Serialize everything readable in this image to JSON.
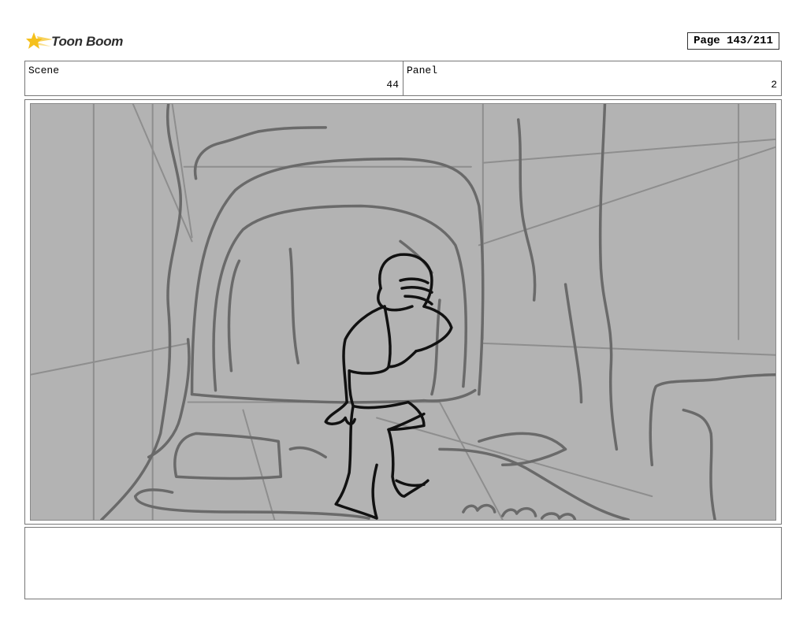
{
  "header": {
    "logo_text": "Toon Boom",
    "page_indicator": "Page 143/211"
  },
  "info": {
    "scene_label": "Scene",
    "scene_value": "44",
    "panel_label": "Panel",
    "panel_value": "2"
  },
  "panel": {
    "background_color": "#b3b3b3",
    "line_color": "#6a6a6a",
    "character_color": "#111111"
  },
  "notes": {
    "text": ""
  }
}
